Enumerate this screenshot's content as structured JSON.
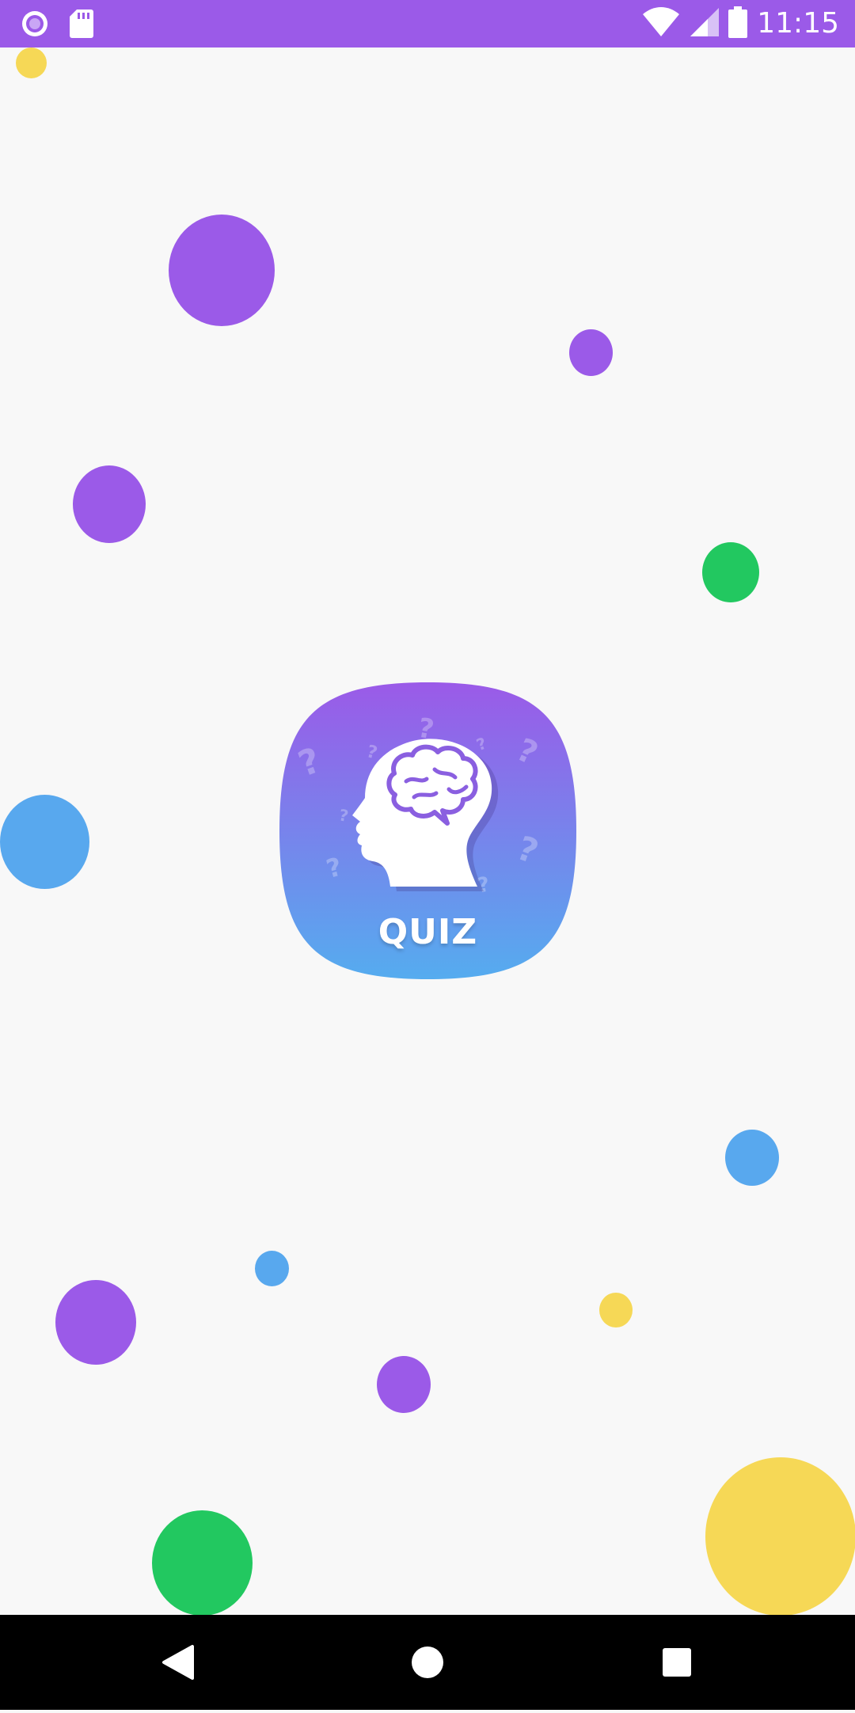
{
  "status_bar": {
    "time": "11:15",
    "background": "#9b5ae8",
    "icons_left": [
      "record-icon",
      "sd-card-icon"
    ],
    "icons_right": [
      "wifi-icon",
      "signal-icon",
      "battery-icon"
    ]
  },
  "splash": {
    "logo_text": "QUIZ",
    "logo_icon": "head-brain-icon",
    "colors": {
      "purple": "#9b5ae8",
      "blue": "#58a8ee",
      "green": "#22c860",
      "yellow": "#f6d856",
      "background": "#f8f8f8"
    }
  },
  "nav_bar": {
    "buttons": [
      "back-icon",
      "home-icon",
      "recents-icon"
    ]
  }
}
